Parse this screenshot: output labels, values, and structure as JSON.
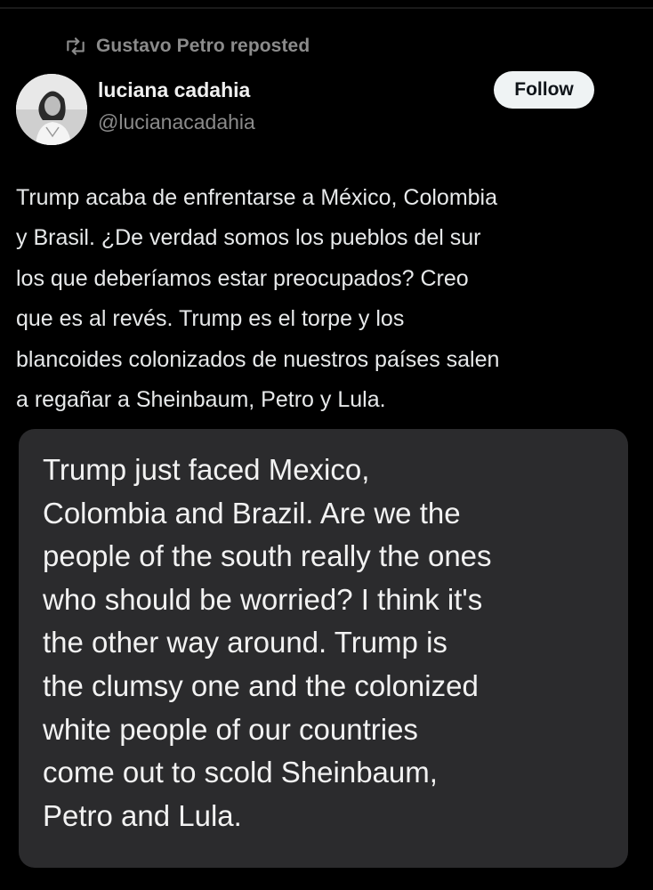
{
  "repost": {
    "label": "Gustavo Petro reposted",
    "icon": "repost-icon"
  },
  "author": {
    "name": "luciana cadahia",
    "handle": "@lucianacadahia",
    "avatar_icon": "avatar-photo"
  },
  "follow_label": "Follow",
  "tweet": {
    "lines": [
      "Trump acaba de enfrentarse a México, Colombia",
      "y Brasil. ¿De verdad somos los pueblos del sur",
      "los que deberíamos estar preocupados? Creo",
      "que es al revés.  Trump es el torpe y los",
      "blancoides colonizados de nuestros países salen",
      "a regañar a Sheinbaum, Petro y Lula."
    ]
  },
  "translation": {
    "lines": [
      "Trump just faced Mexico,",
      "Colombia and Brazil. Are we the",
      "people of the south really the ones",
      "who should be worried? I think it's",
      "the other way around.  Trump is",
      "the clumsy one and the colonized",
      "white people of our countries",
      "come out to scold Sheinbaum,",
      "Petro and Lula."
    ]
  },
  "colors": {
    "background": "#000000",
    "text": "#e7e9ea",
    "muted": "#8b8b8b",
    "follow_bg": "#eff3f4",
    "translation_bg": "#2b2b2d"
  }
}
